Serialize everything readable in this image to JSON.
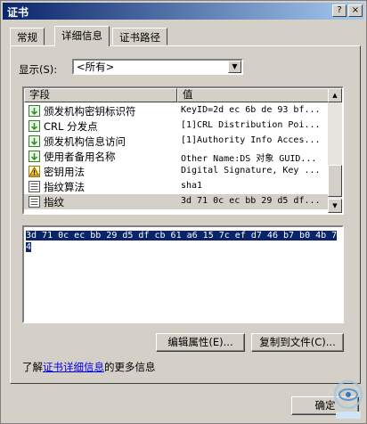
{
  "window": {
    "title": "证书",
    "help_glyph": "?",
    "close_glyph": "×"
  },
  "tabs": [
    {
      "label": "常规"
    },
    {
      "label": "详细信息"
    },
    {
      "label": "证书路径"
    }
  ],
  "show": {
    "label": "显示(S):",
    "value": "<所有>",
    "dropdown_glyph": "▼"
  },
  "list": {
    "columns": [
      "字段",
      "值"
    ],
    "rows": [
      {
        "field": "颁发机构密钥标识符",
        "value": "KeyID=2d ec 6b de 93 bf...",
        "icon": "ext-icon"
      },
      {
        "field": "CRL 分发点",
        "value": "[1]CRL Distribution Poi...",
        "icon": "ext-icon"
      },
      {
        "field": "颁发机构信息访问",
        "value": "[1]Authority Info Acces...",
        "icon": "ext-icon"
      },
      {
        "field": "使用者备用名称",
        "value": "Other Name:DS 对象 GUID...",
        "icon": "ext-icon"
      },
      {
        "field": "密钥用法",
        "value": "Digital Signature, Key ...",
        "icon": "warning-ext-icon"
      },
      {
        "field": "指纹算法",
        "value": "sha1",
        "icon": "property-icon"
      },
      {
        "field": "指纹",
        "value": "3d 71 0c ec bb 29 d5 df...",
        "icon": "property-icon",
        "selected": true
      }
    ],
    "scroll_up": "▲",
    "scroll_down": "▼"
  },
  "detail": {
    "text": " 3d 71 0c ec bb 29 d5 df cb 61 a6 15 7c ef d7 46 b7 b0 4b 74"
  },
  "buttons": {
    "edit": "编辑属性(E)...",
    "copy": "复制到文件(C)...",
    "ok": "确定"
  },
  "learn": {
    "prefix": "了解",
    "link": "证书详细信息",
    "suffix": "的更多信息"
  },
  "colors": {
    "selection": "#0a246a",
    "face": "#d4d0c8",
    "link": "#0000ee"
  }
}
